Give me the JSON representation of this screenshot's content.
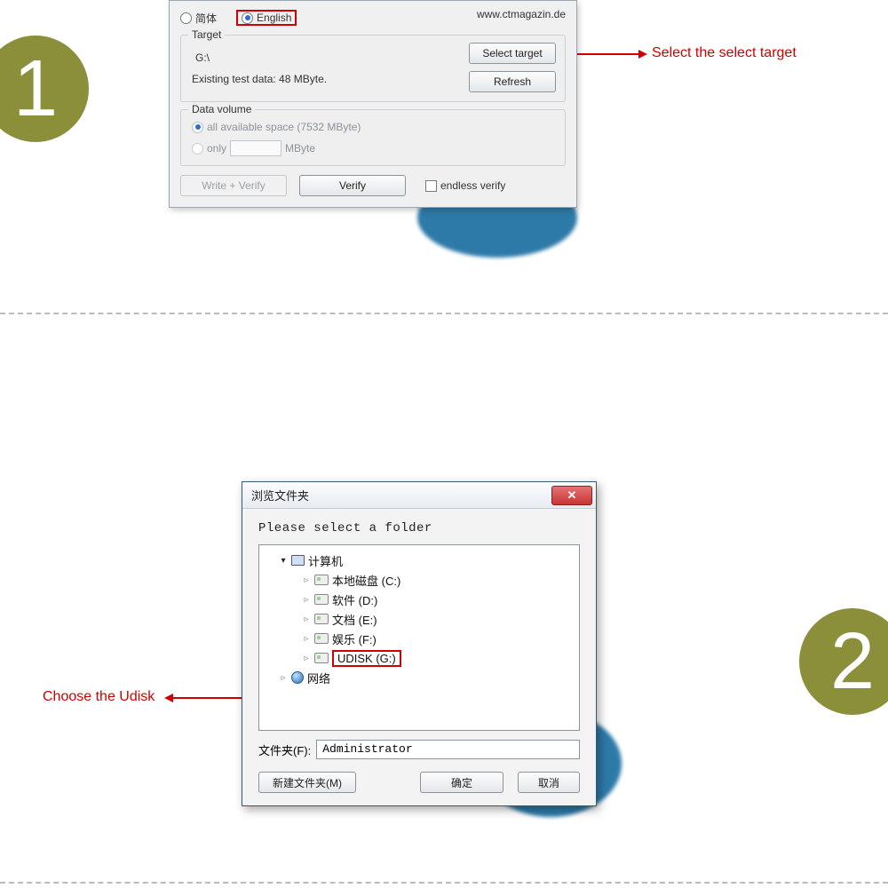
{
  "step1_num": "1",
  "step2_num": "2",
  "annot1": "Select the select target",
  "annot2": "Choose the Udisk",
  "panel1": {
    "lang_cn": "简体",
    "lang_en": "English",
    "website": "www.ctmagazin.de",
    "target_title": "Target",
    "target_path": "G:\\",
    "select_target": "Select target",
    "existing": "Existing test data: 48 MByte.",
    "refresh": "Refresh",
    "dv_title": "Data volume",
    "dv_all": "all available space (7532 MByte)",
    "dv_only": "only",
    "dv_unit": "MByte",
    "write_verify": "Write + Verify",
    "verify": "Verify",
    "endless": "endless verify"
  },
  "panel2": {
    "title": "浏览文件夹",
    "prompt": "Please select a folder",
    "computer": "计算机",
    "drives": {
      "c": "本地磁盘 (C:)",
      "d": "软件 (D:)",
      "e": "文档 (E:)",
      "f": "娱乐 (F:)",
      "g": "UDISK (G:)"
    },
    "network": "网络",
    "folder_lbl": "文件夹(F):",
    "folder_val": "Administrator",
    "new_folder": "新建文件夹(M)",
    "ok": "确定",
    "cancel": "取消"
  }
}
